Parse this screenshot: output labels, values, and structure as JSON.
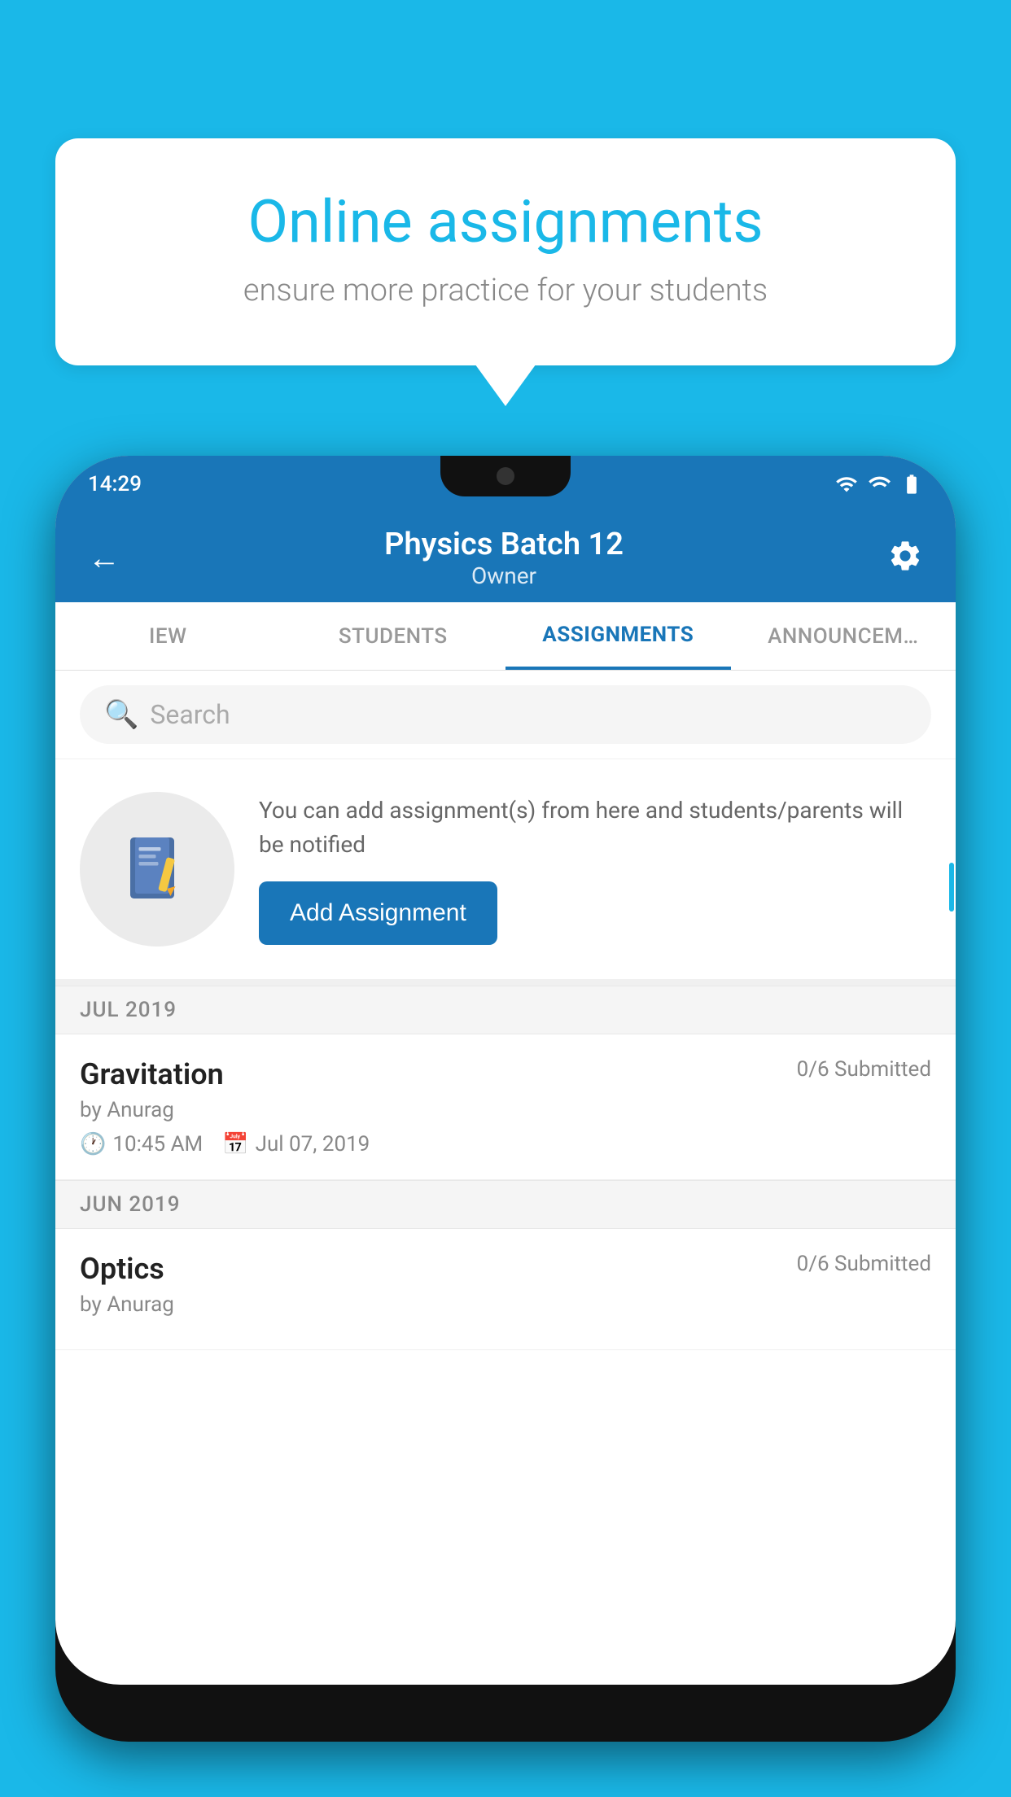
{
  "background_color": "#1ab8e8",
  "bubble": {
    "title": "Online assignments",
    "subtitle": "ensure more practice for your students"
  },
  "phone": {
    "status_time": "14:29",
    "header": {
      "title": "Physics Batch 12",
      "subtitle": "Owner",
      "back_label": "←",
      "settings_label": "⚙"
    },
    "tabs": [
      {
        "label": "IEW",
        "active": false
      },
      {
        "label": "STUDENTS",
        "active": false
      },
      {
        "label": "ASSIGNMENTS",
        "active": true
      },
      {
        "label": "ANNOUNCEM…",
        "active": false
      }
    ],
    "search": {
      "placeholder": "Search"
    },
    "promo": {
      "text": "You can add assignment(s) from here and students/parents will be notified",
      "button_label": "Add Assignment"
    },
    "sections": [
      {
        "month_label": "JUL 2019",
        "assignments": [
          {
            "name": "Gravitation",
            "submitted": "0/6 Submitted",
            "by": "by Anurag",
            "time": "10:45 AM",
            "date": "Jul 07, 2019"
          }
        ]
      },
      {
        "month_label": "JUN 2019",
        "assignments": [
          {
            "name": "Optics",
            "submitted": "0/6 Submitted",
            "by": "by Anurag",
            "time": "",
            "date": ""
          }
        ]
      }
    ]
  }
}
